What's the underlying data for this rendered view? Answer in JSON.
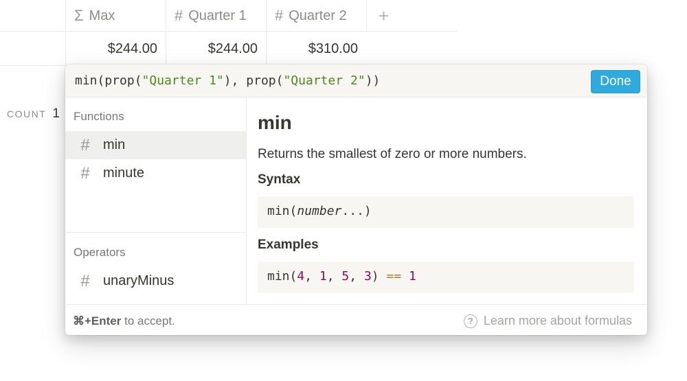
{
  "table": {
    "columns": [
      {
        "icon": "sigma-icon",
        "glyph": "Σ",
        "label": "Max"
      },
      {
        "icon": "hash-icon",
        "glyph": "#",
        "label": "Quarter 1"
      },
      {
        "icon": "hash-icon",
        "glyph": "#",
        "label": "Quarter 2"
      }
    ],
    "add_glyph": "+",
    "row": [
      "$244.00",
      "$244.00",
      "$310.00"
    ],
    "count_label": "COUNT",
    "count_value": "1"
  },
  "formula": {
    "p1": "min(prop(",
    "s1": "\"Quarter 1\"",
    "p2": "), prop(",
    "s2": "\"Quarter 2\"",
    "p3": "))",
    "done_label": "Done",
    "accent": "#2eaadc"
  },
  "sidebar": {
    "functions_title": "Functions",
    "functions": [
      {
        "icon": "hash-icon",
        "glyph": "#",
        "label": "min"
      },
      {
        "icon": "hash-icon",
        "glyph": "#",
        "label": "minute"
      }
    ],
    "operators_title": "Operators",
    "operators": [
      {
        "icon": "hash-icon",
        "glyph": "#",
        "label": "unaryMinus"
      }
    ]
  },
  "detail": {
    "name": "min",
    "description": "Returns the smallest of zero or more numbers.",
    "syntax_title": "Syntax",
    "syntax_fn": "min(",
    "syntax_arg": "number",
    "syntax_end": "...)",
    "examples_title": "Examples",
    "ex": {
      "open": "min(",
      "a": "4",
      "c1": ", ",
      "b": "1",
      "c2": ", ",
      "c": "5",
      "c3": ", ",
      "d": "3",
      "close": ") ",
      "op": "==",
      "sp": " ",
      "result": "1"
    }
  },
  "footer": {
    "shortcut": "⌘+Enter",
    "hint_rest": " to accept.",
    "help_glyph": "?",
    "learn_more": "Learn more about formulas"
  }
}
